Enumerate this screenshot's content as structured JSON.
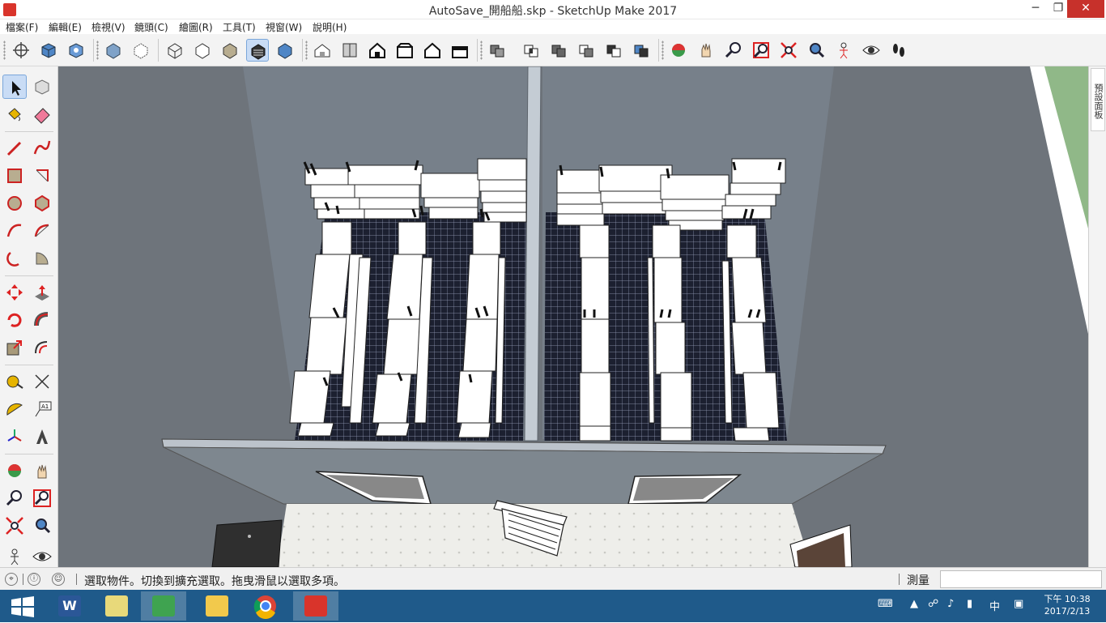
{
  "window": {
    "title": "AutoSave_開船船.skp - SketchUp Make 2017",
    "minimize": "─",
    "restore": "❐",
    "close": "✕"
  },
  "menu": [
    "檔案(F)",
    "編輯(E)",
    "檢視(V)",
    "鏡頭(C)",
    "繪圖(R)",
    "工具(T)",
    "視窗(W)",
    "說明(H)"
  ],
  "toolbar_icons": [
    "select-camera-icon",
    "component-icon",
    "3d-warehouse-icon",
    "xray-icon",
    "back-edges-icon",
    "wireframe-icon",
    "hidden-line-icon",
    "shaded-icon",
    "shaded-texture-icon",
    "monochrome-icon",
    "iso-view-icon",
    "top-view-icon",
    "front-view-icon",
    "right-view-icon",
    "back-view-icon",
    "left-view-icon",
    "outer-shell-icon",
    "intersect-icon",
    "union-icon",
    "subtract-icon",
    "trim-icon",
    "split-icon",
    "orbit-icon",
    "pan-icon",
    "zoom-icon",
    "zoom-window-icon",
    "zoom-extents-icon",
    "previous-view-icon",
    "position-camera-icon",
    "look-around-icon",
    "walk-icon"
  ],
  "palette_icons": [
    "select-icon",
    "make-component-icon",
    "paint-bucket-icon",
    "eraser-icon",
    "line-icon",
    "freehand-icon",
    "rectangle-icon",
    "rotated-rectangle-icon",
    "circle-icon",
    "polygon-icon",
    "arc-icon",
    "two-point-arc-icon",
    "three-point-arc-icon",
    "pie-icon",
    "move-icon",
    "push-pull-icon",
    "rotate-icon",
    "follow-me-icon",
    "scale-icon",
    "offset-icon",
    "tape-measure-icon",
    "dimension-icon",
    "protractor-icon",
    "text-icon",
    "axes-icon",
    "3d-text-icon",
    "orbit-icon",
    "pan-icon",
    "zoom-icon",
    "zoom-window-icon",
    "zoom-extents-icon",
    "previous-icon",
    "position-camera-icon",
    "look-around-icon"
  ],
  "tray": {
    "tab_label": "預設面板"
  },
  "status": {
    "message": "選取物件。切換到擴充選取。拖曳滑鼠以選取多項。",
    "measure_label": "測量",
    "measure_value": ""
  },
  "taskbar": {
    "apps": [
      "start-icon",
      "word-icon",
      "file-manager-icon",
      "media-player-icon",
      "file-explorer-icon",
      "chrome-icon",
      "sketchup-icon"
    ],
    "ime": "中",
    "clock_time": "下午 10:38",
    "clock_date": "2017/2/13"
  }
}
